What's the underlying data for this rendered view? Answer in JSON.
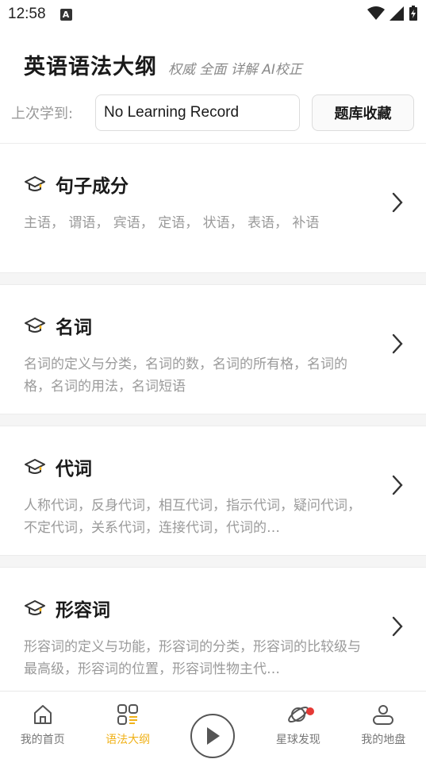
{
  "status_bar": {
    "time": "12:58",
    "badge": "A"
  },
  "header": {
    "title": "英语语法大纲",
    "subtitle": "权威 全面 详解 AI校正"
  },
  "record": {
    "label": "上次学到:",
    "value": "No Learning Record",
    "favorites_label": "题库收藏"
  },
  "topics": [
    {
      "title": "句子成分",
      "desc": "主语， 谓语， 宾语， 定语， 状语， 表语， 补语"
    },
    {
      "title": "名词",
      "desc": "名词的定义与分类，名词的数，名词的所有格，名词的格，名词的用法，名词短语"
    },
    {
      "title": "代词",
      "desc": "人称代词，反身代词，相互代词，指示代词，疑问代词，不定代词，关系代词，连接代词，代词的…"
    },
    {
      "title": "形容词",
      "desc": "形容词的定义与功能，形容词的分类，形容词的比较级与最高级，形容词的位置，形容词性物主代…"
    }
  ],
  "tabs": {
    "home": "我的首页",
    "grammar": "语法大纲",
    "discover": "星球发现",
    "profile": "我的地盘"
  },
  "colors": {
    "accent": "#f0b21a",
    "notification": "#e53935"
  },
  "active_tab": "grammar"
}
